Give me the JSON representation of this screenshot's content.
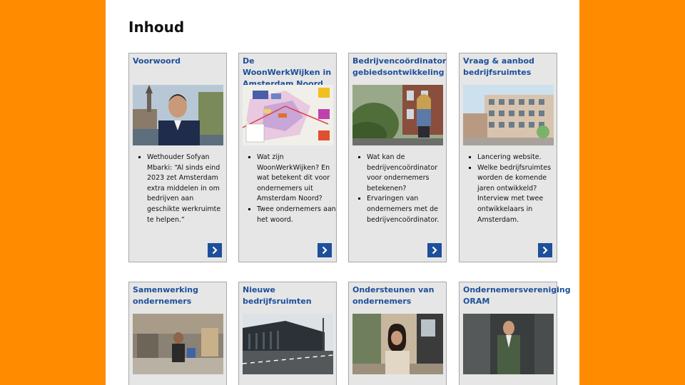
{
  "title": "Inhoud",
  "cards": [
    {
      "title": "Voorwoord",
      "image": "portrait-man-amsterdam-canal",
      "bullets": [
        "Wethouder Sofyan Mbarki: “Al sinds eind 2023 zet Amsterdam extra middelen in om bedrijven aan geschikte werkruimte te helpen.”"
      ],
      "arrow_icon": "chevron-right-icon"
    },
    {
      "title": "De WoonWerkWijken in Amsterdam Noord",
      "image": "map-woonwerkwijken",
      "bullets": [
        "Wat zijn WoonWerkWijken? En wat betekent dit voor ondernemers uit Amsterdam Noord?",
        "Twee ondernemers aan het woord."
      ],
      "arrow_icon": "chevron-right-icon"
    },
    {
      "title": "Bedrijvencoördinator gebiedsontwikkeling",
      "image": "woman-seated-in-garden",
      "bullets": [
        "Wat kan de bedrijvencoördinator voor ondernemers betekenen?",
        "Ervaringen van ondernemers met de bedrijvencoördinator."
      ],
      "arrow_icon": "chevron-right-icon"
    },
    {
      "title": "Vraag & aanbod bedrijfsruimtes",
      "image": "new-building-render",
      "bullets": [
        "Lancering website.",
        "Welke bedrijfsruimtes worden de komende jaren ontwikkeld? Interview met twee ontwikkelaars in Amsterdam."
      ],
      "arrow_icon": "chevron-right-icon"
    },
    {
      "title": "Samenwerking ondernemers",
      "image": "workshop-interior",
      "bullets": [],
      "arrow_icon": ""
    },
    {
      "title": "Nieuwe bedrijfsruimten",
      "image": "modern-business-building",
      "bullets": [],
      "arrow_icon": ""
    },
    {
      "title": "Ondersteunen van ondernemers",
      "image": "woman-street-portrait",
      "bullets": [],
      "arrow_icon": ""
    },
    {
      "title": "Ondernemersvereniging ORAM",
      "image": "man-in-suit-portrait",
      "bullets": [],
      "arrow_icon": ""
    }
  ]
}
